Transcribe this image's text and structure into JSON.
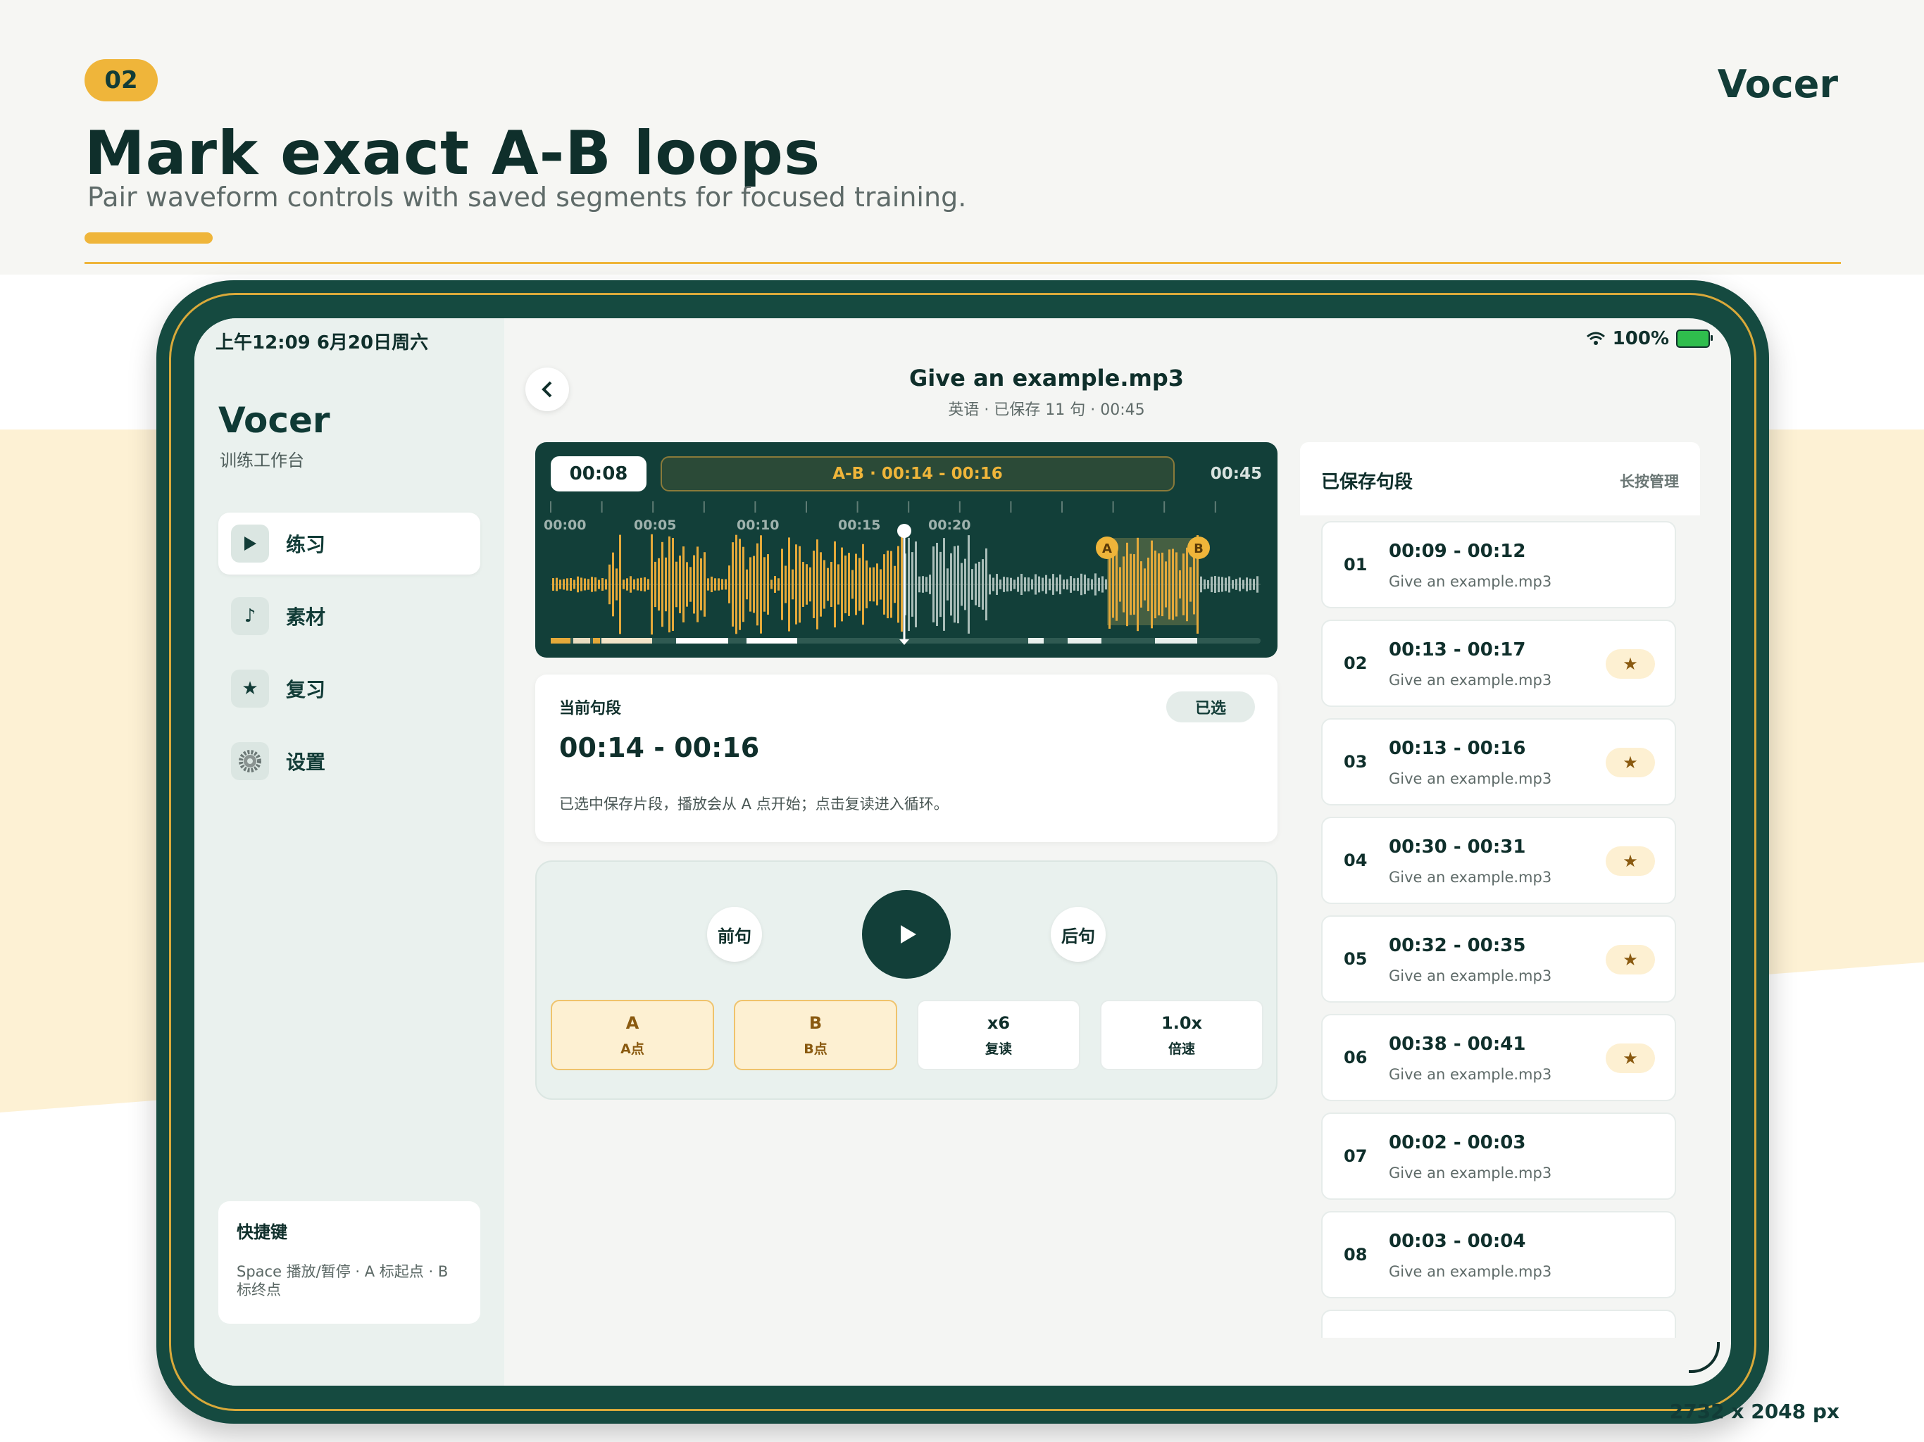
{
  "slide": {
    "badge": "02",
    "brand": "Vocer",
    "headline": "Mark exact A-B loops",
    "subhead": "Pair waveform controls with saved segments for focused training.",
    "footnote": "2732 x 2048 px"
  },
  "status_bar": {
    "time_date": "上午12:09   6月20日周六",
    "battery": "100%"
  },
  "sidebar": {
    "title": "Vocer",
    "subtitle": "训练工作台",
    "items": [
      {
        "label": "练习",
        "icon": "play-icon",
        "active": true
      },
      {
        "label": "素材",
        "icon": "music-note-icon",
        "active": false
      },
      {
        "label": "复习",
        "icon": "star-icon",
        "active": false
      },
      {
        "label": "设置",
        "icon": "gear-icon",
        "active": false
      }
    ],
    "shortcut": {
      "title": "快捷键",
      "text": "Space 播放/暂停 · A 标起点 · B 标终点"
    }
  },
  "player": {
    "file_title": "Give an example.mp3",
    "file_meta": "英语 · 已保存 11 句 · 00:45",
    "waveform": {
      "current_time": "00:08",
      "ab_range": "A-B · 00:14 - 00:16",
      "total_time": "00:45",
      "tick_labels": [
        "00:00",
        "00:05",
        "00:10",
        "00:15",
        "00:20"
      ],
      "marker_a": "A",
      "marker_b": "B",
      "colors": {
        "played": "#e5a93a",
        "unplayed": "#a9bdb8",
        "loop": "#e5a93a"
      }
    },
    "current_segment": {
      "label": "当前句段",
      "chip": "已选",
      "range": "00:14 - 00:16",
      "description": "已选中保存片段，播放会从 A 点开始；点击复读进入循环。"
    },
    "controls": {
      "prev": "前句",
      "next": "后句",
      "buttons": [
        {
          "main": "A",
          "sub": "A点"
        },
        {
          "main": "B",
          "sub": "B点"
        },
        {
          "main": "x6",
          "sub": "复读"
        },
        {
          "main": "1.0x",
          "sub": "倍速"
        }
      ]
    }
  },
  "saved": {
    "title": "已保存句段",
    "manage": "长按管理",
    "items": [
      {
        "num": "01",
        "time": "00:09 - 00:12",
        "file": "Give an example.mp3",
        "starred": false
      },
      {
        "num": "02",
        "time": "00:13 - 00:17",
        "file": "Give an example.mp3",
        "starred": true
      },
      {
        "num": "03",
        "time": "00:13 - 00:16",
        "file": "Give an example.mp3",
        "starred": true
      },
      {
        "num": "04",
        "time": "00:30 - 00:31",
        "file": "Give an example.mp3",
        "starred": true
      },
      {
        "num": "05",
        "time": "00:32 - 00:35",
        "file": "Give an example.mp3",
        "starred": true
      },
      {
        "num": "06",
        "time": "00:38 - 00:41",
        "file": "Give an example.mp3",
        "starred": true
      },
      {
        "num": "07",
        "time": "00:02 - 00:03",
        "file": "Give an example.mp3",
        "starred": false
      },
      {
        "num": "08",
        "time": "00:03 - 00:04",
        "file": "Give an example.mp3",
        "starred": false
      }
    ]
  }
}
